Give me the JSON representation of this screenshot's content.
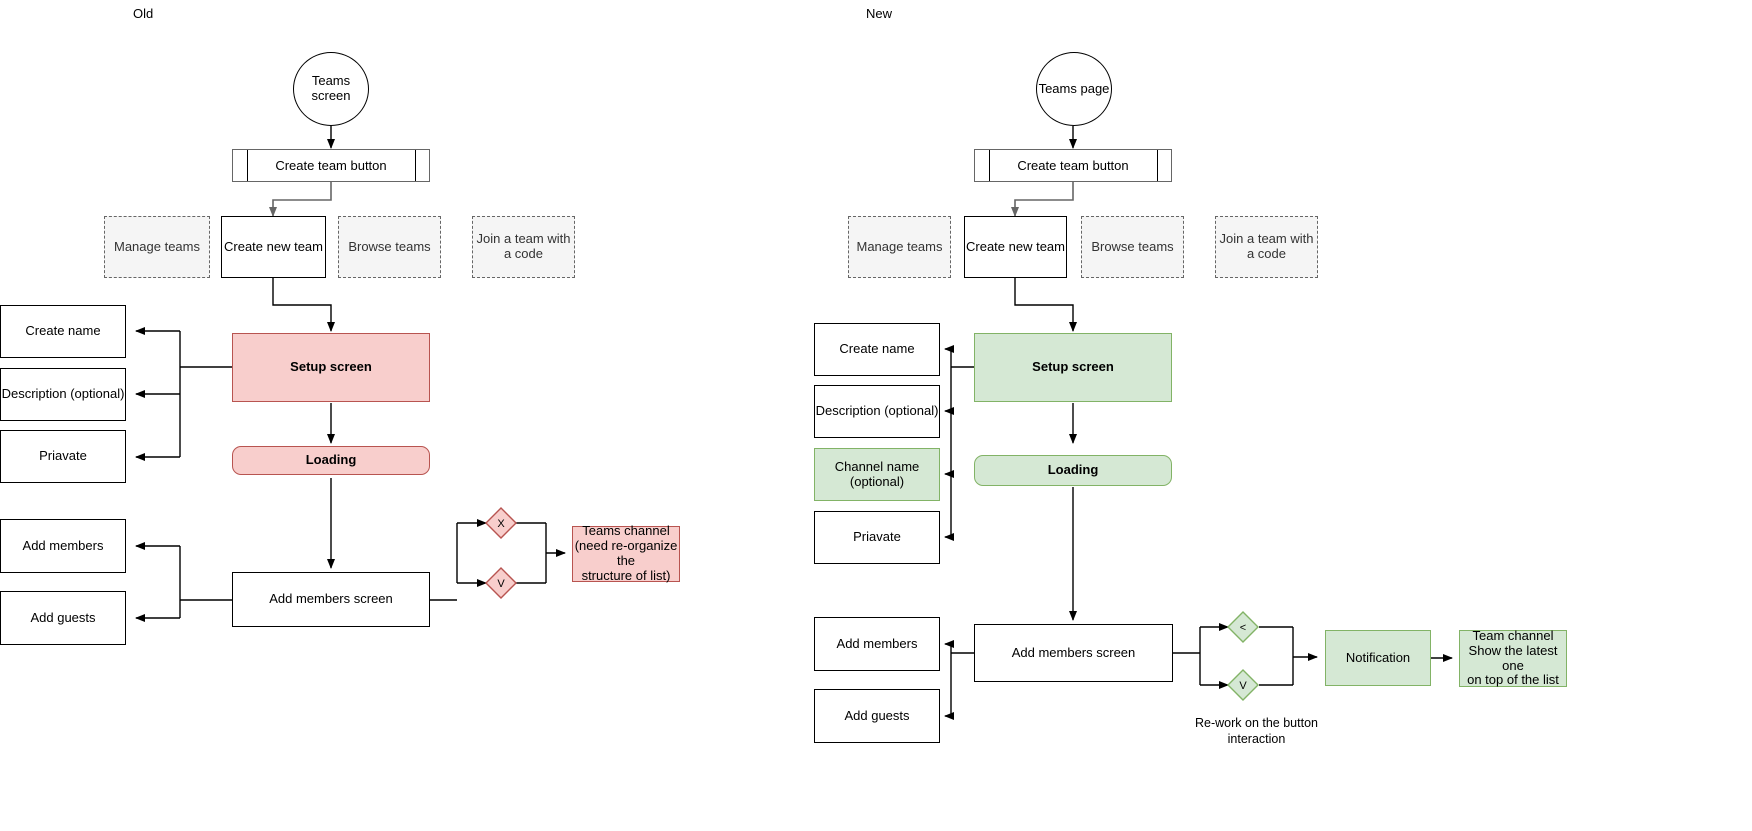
{
  "diagram": {
    "type": "flowchart",
    "title_old": "Old",
    "title_new": "New",
    "colors": {
      "red_fill": "#f8cecc",
      "red_stroke": "#b85450",
      "green_fill": "#d5e8d4",
      "green_stroke": "#82b366",
      "dashed_fill": "#f5f5f5",
      "dashed_stroke": "#666666",
      "default_stroke": "#000000",
      "canvas": "#ffffff"
    }
  },
  "old": {
    "column_label": "Old",
    "start": "Teams screen",
    "create_team_button": "Create team button",
    "menu": [
      "Manage teams",
      "Create new team",
      "Browse teams",
      "Join a team with a code"
    ],
    "setup_screen": "Setup screen",
    "loading": "Loading",
    "setup_fields": [
      "Create name",
      "Description (optional)",
      "Priavate"
    ],
    "add_members_screen": "Add members screen",
    "member_fields": [
      "Add members",
      "Add guests"
    ],
    "decisions": [
      "X",
      "V"
    ],
    "result": "Teams channel\n(need re-organize the\nstructure of list)",
    "result_line1": "Teams channel",
    "result_line2": "(need re-organize the",
    "result_line3": "structure of list)"
  },
  "new": {
    "column_label": "New",
    "start": "Teams page",
    "create_team_button": "Create team button",
    "menu": [
      "Manage teams",
      "Create new team",
      "Browse teams",
      "Join a team with a code"
    ],
    "setup_screen": "Setup screen",
    "loading": "Loading",
    "setup_fields": [
      "Create name",
      "Description (optional)",
      "Channel name (optional)",
      "Priavate"
    ],
    "add_members_screen": "Add members screen",
    "member_fields": [
      "Add members",
      "Add guests"
    ],
    "decisions": [
      "<",
      "V"
    ],
    "notification": "Notification",
    "result_line1": "Team channel",
    "result_line2": "Show the latest one",
    "result_line3": "on top of the list",
    "caption_line1": "Re-work on the button",
    "caption_line2": "interaction"
  }
}
